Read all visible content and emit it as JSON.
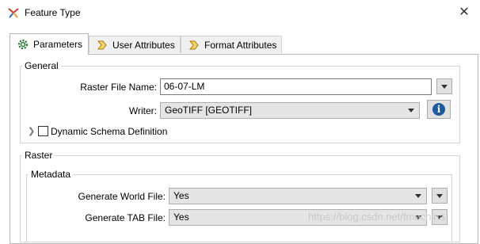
{
  "window": {
    "title": "Feature Type"
  },
  "tabs": [
    {
      "label": "Parameters",
      "icon": "gear-icon"
    },
    {
      "label": "User Attributes",
      "icon": "arrow-right-icon"
    },
    {
      "label": "Format Attributes",
      "icon": "arrow-right-icon"
    }
  ],
  "general": {
    "title": "General",
    "raster_file_name": {
      "label": "Raster File Name:",
      "value": "06-07-LM"
    },
    "writer": {
      "label": "Writer:",
      "value": "GeoTIFF [GEOTIFF]"
    },
    "dynamic_schema": {
      "label": "Dynamic Schema Definition",
      "checked": false
    }
  },
  "raster": {
    "title": "Raster",
    "metadata": {
      "title": "Metadata",
      "generate_world_file": {
        "label": "Generate World File:",
        "value": "Yes"
      },
      "generate_tab_file": {
        "label": "Generate TAB File:",
        "value": "Yes"
      }
    }
  },
  "watermark": "https://blog.csdn.net/fmechina",
  "colors": {
    "info_icon": "#1e5a9c",
    "tab_border": "#b8b8b8"
  }
}
